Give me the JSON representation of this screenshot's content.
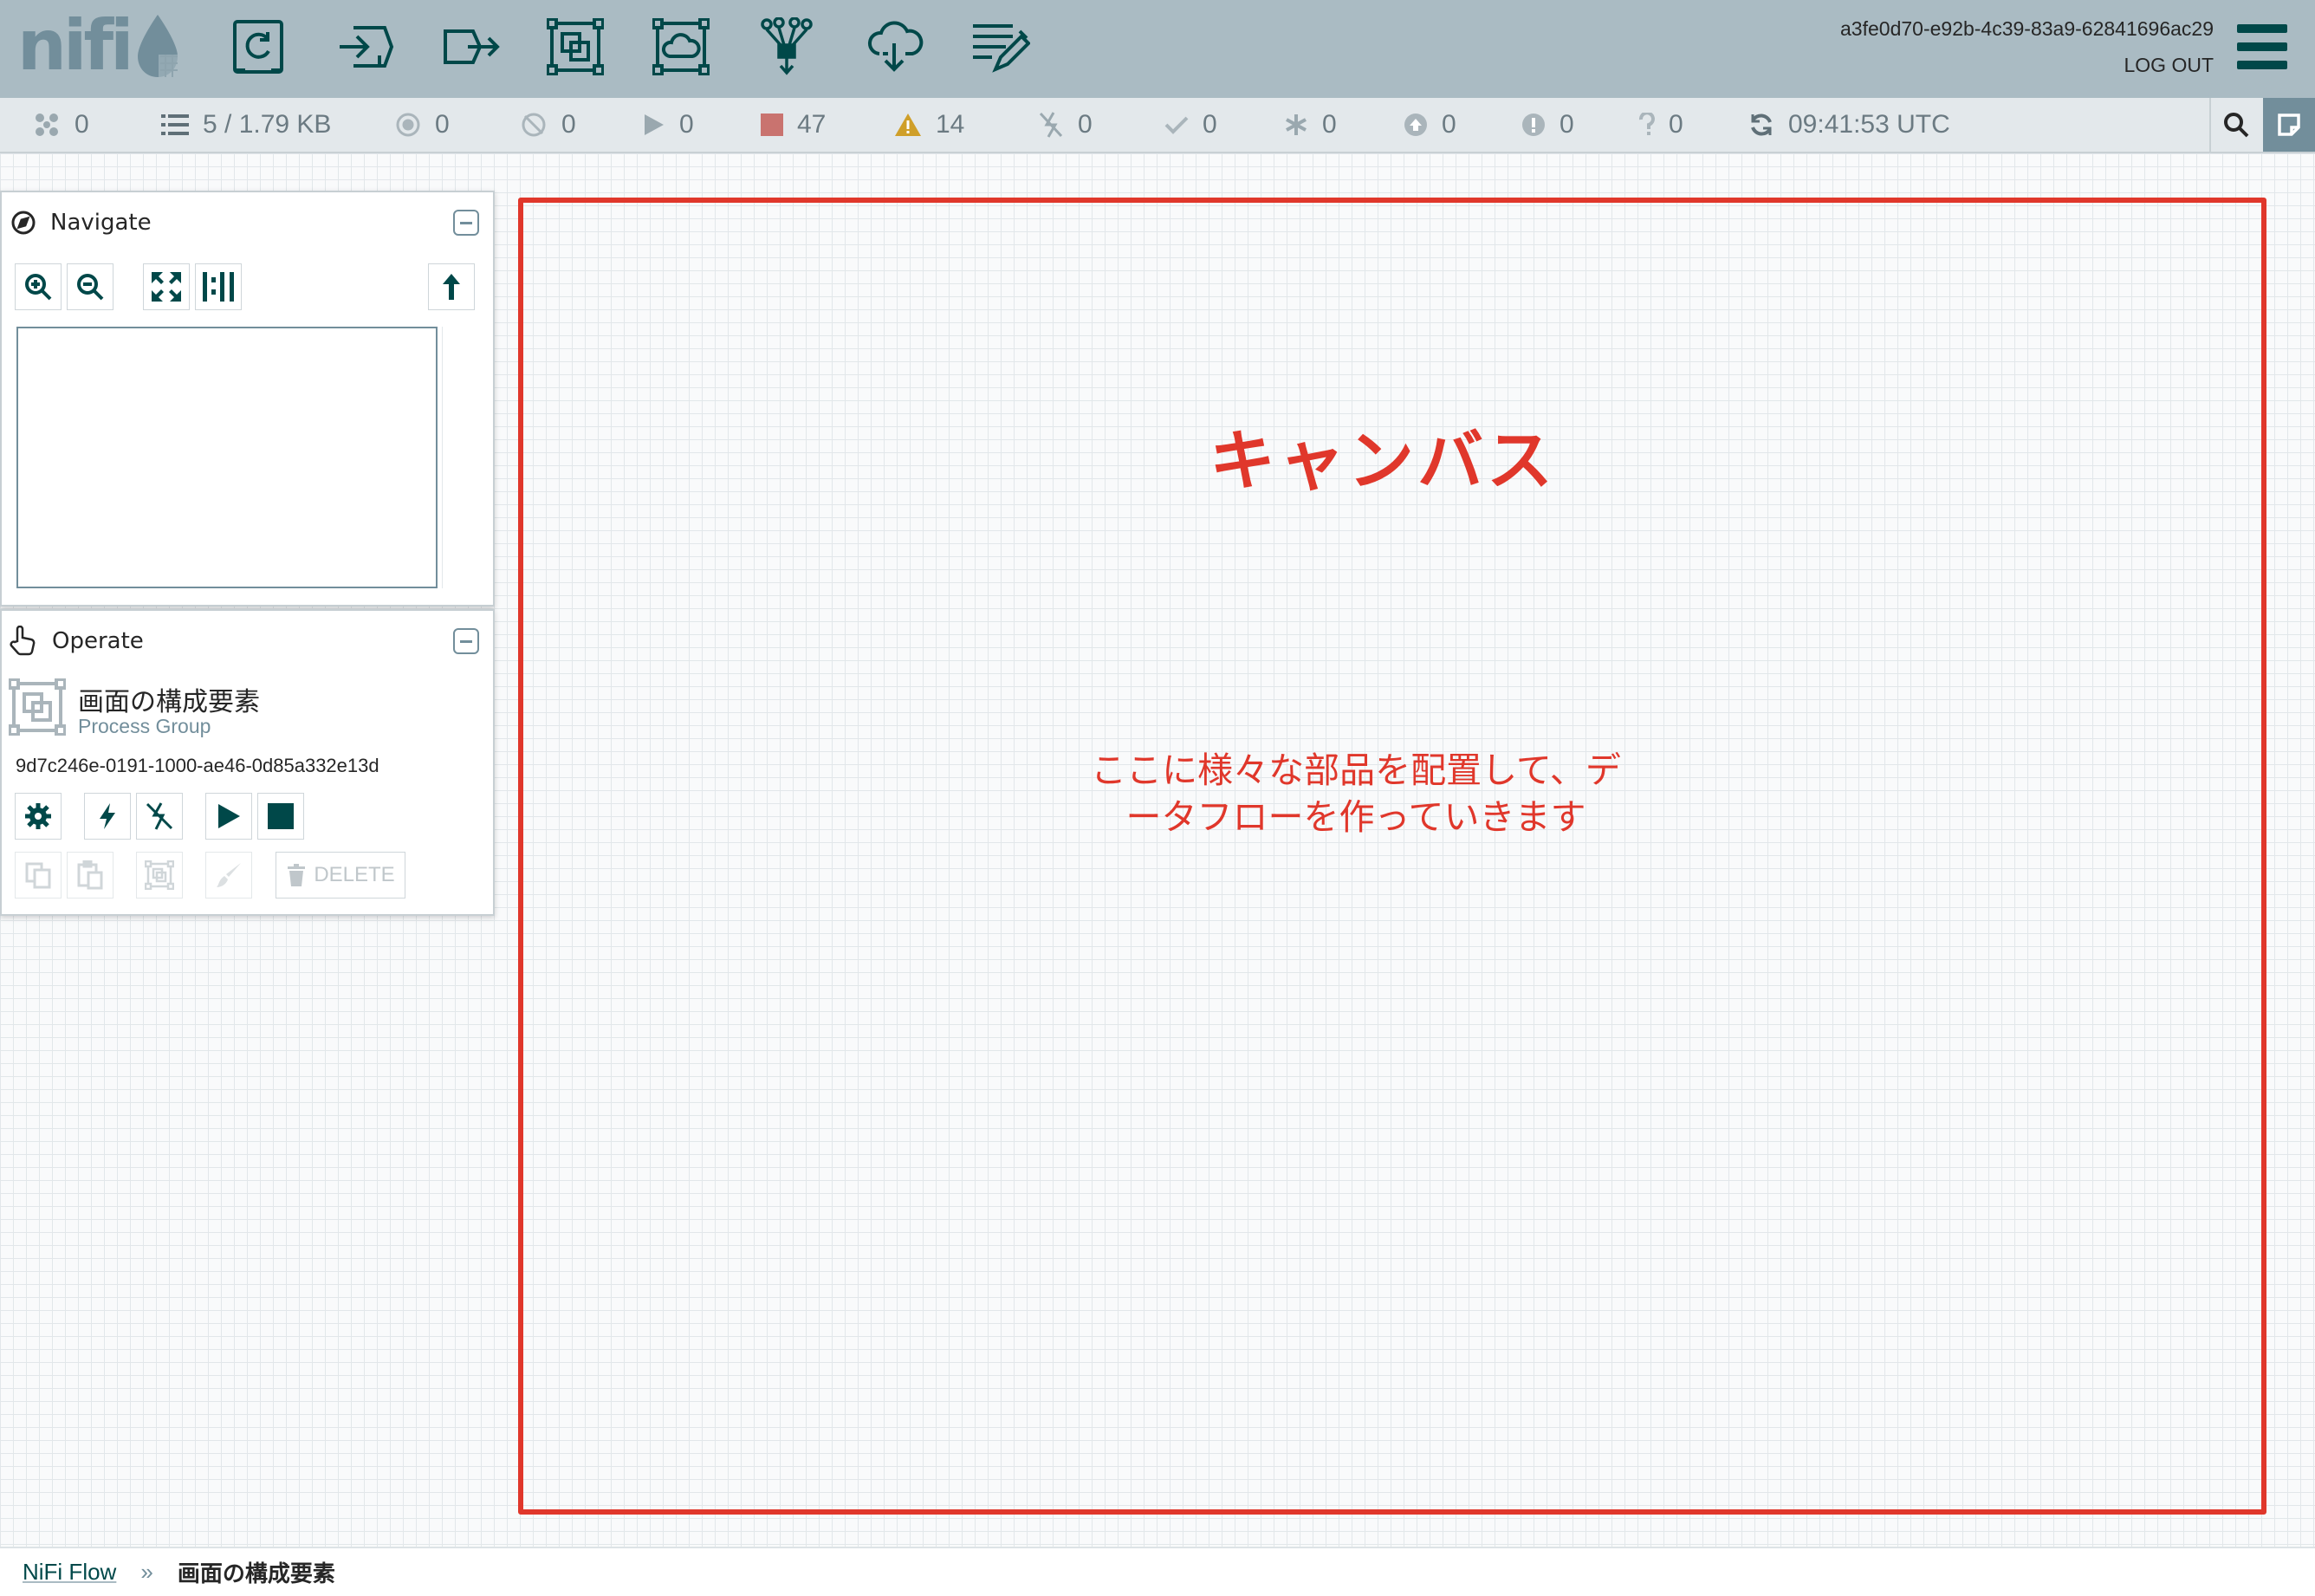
{
  "header": {
    "logo_text": "nifi",
    "user_id": "a3fe0d70-e92b-4c39-83a9-62841696ac29",
    "logout_label": "LOG OUT",
    "toolbar": [
      {
        "name": "processor-button",
        "icon": "processor-icon"
      },
      {
        "name": "input-port-button",
        "icon": "input-port-icon"
      },
      {
        "name": "output-port-button",
        "icon": "output-port-icon"
      },
      {
        "name": "process-group-button",
        "icon": "process-group-icon"
      },
      {
        "name": "remote-process-group-button",
        "icon": "remote-process-group-icon"
      },
      {
        "name": "funnel-button",
        "icon": "funnel-icon"
      },
      {
        "name": "template-button",
        "icon": "template-icon"
      },
      {
        "name": "label-button",
        "icon": "label-icon"
      }
    ]
  },
  "status": {
    "active_threads": "0",
    "queued": "5 / 1.79 KB",
    "transmitting": "0",
    "not_transmitting": "0",
    "running": "0",
    "stopped": "47",
    "invalid": "14",
    "disabled": "0",
    "up_to_date": "0",
    "locally_modified": "0",
    "stale": "0",
    "locally_modified_stale": "0",
    "sync_failure": "0",
    "last_refreshed": "09:41:53 UTC"
  },
  "navigate": {
    "title": "Navigate"
  },
  "operate": {
    "title": "Operate",
    "component_name": "画面の構成要素",
    "component_type": "Process Group",
    "component_id": "9d7c246e-0191-1000-ae46-0d85a332e13d",
    "delete_label": "DELETE"
  },
  "canvas": {
    "title": "キャンバス",
    "note": "ここに様々な部品を配置して、データフローを作っていきます"
  },
  "breadcrumbs": {
    "root": "NiFi Flow",
    "separator": "»",
    "current": "画面の構成要素"
  },
  "colors": {
    "header_bg": "#aabbc3",
    "accent": "#004849",
    "annotation_red": "#e0372b",
    "stopped": "#c9736f",
    "invalid": "#cf9f29"
  }
}
